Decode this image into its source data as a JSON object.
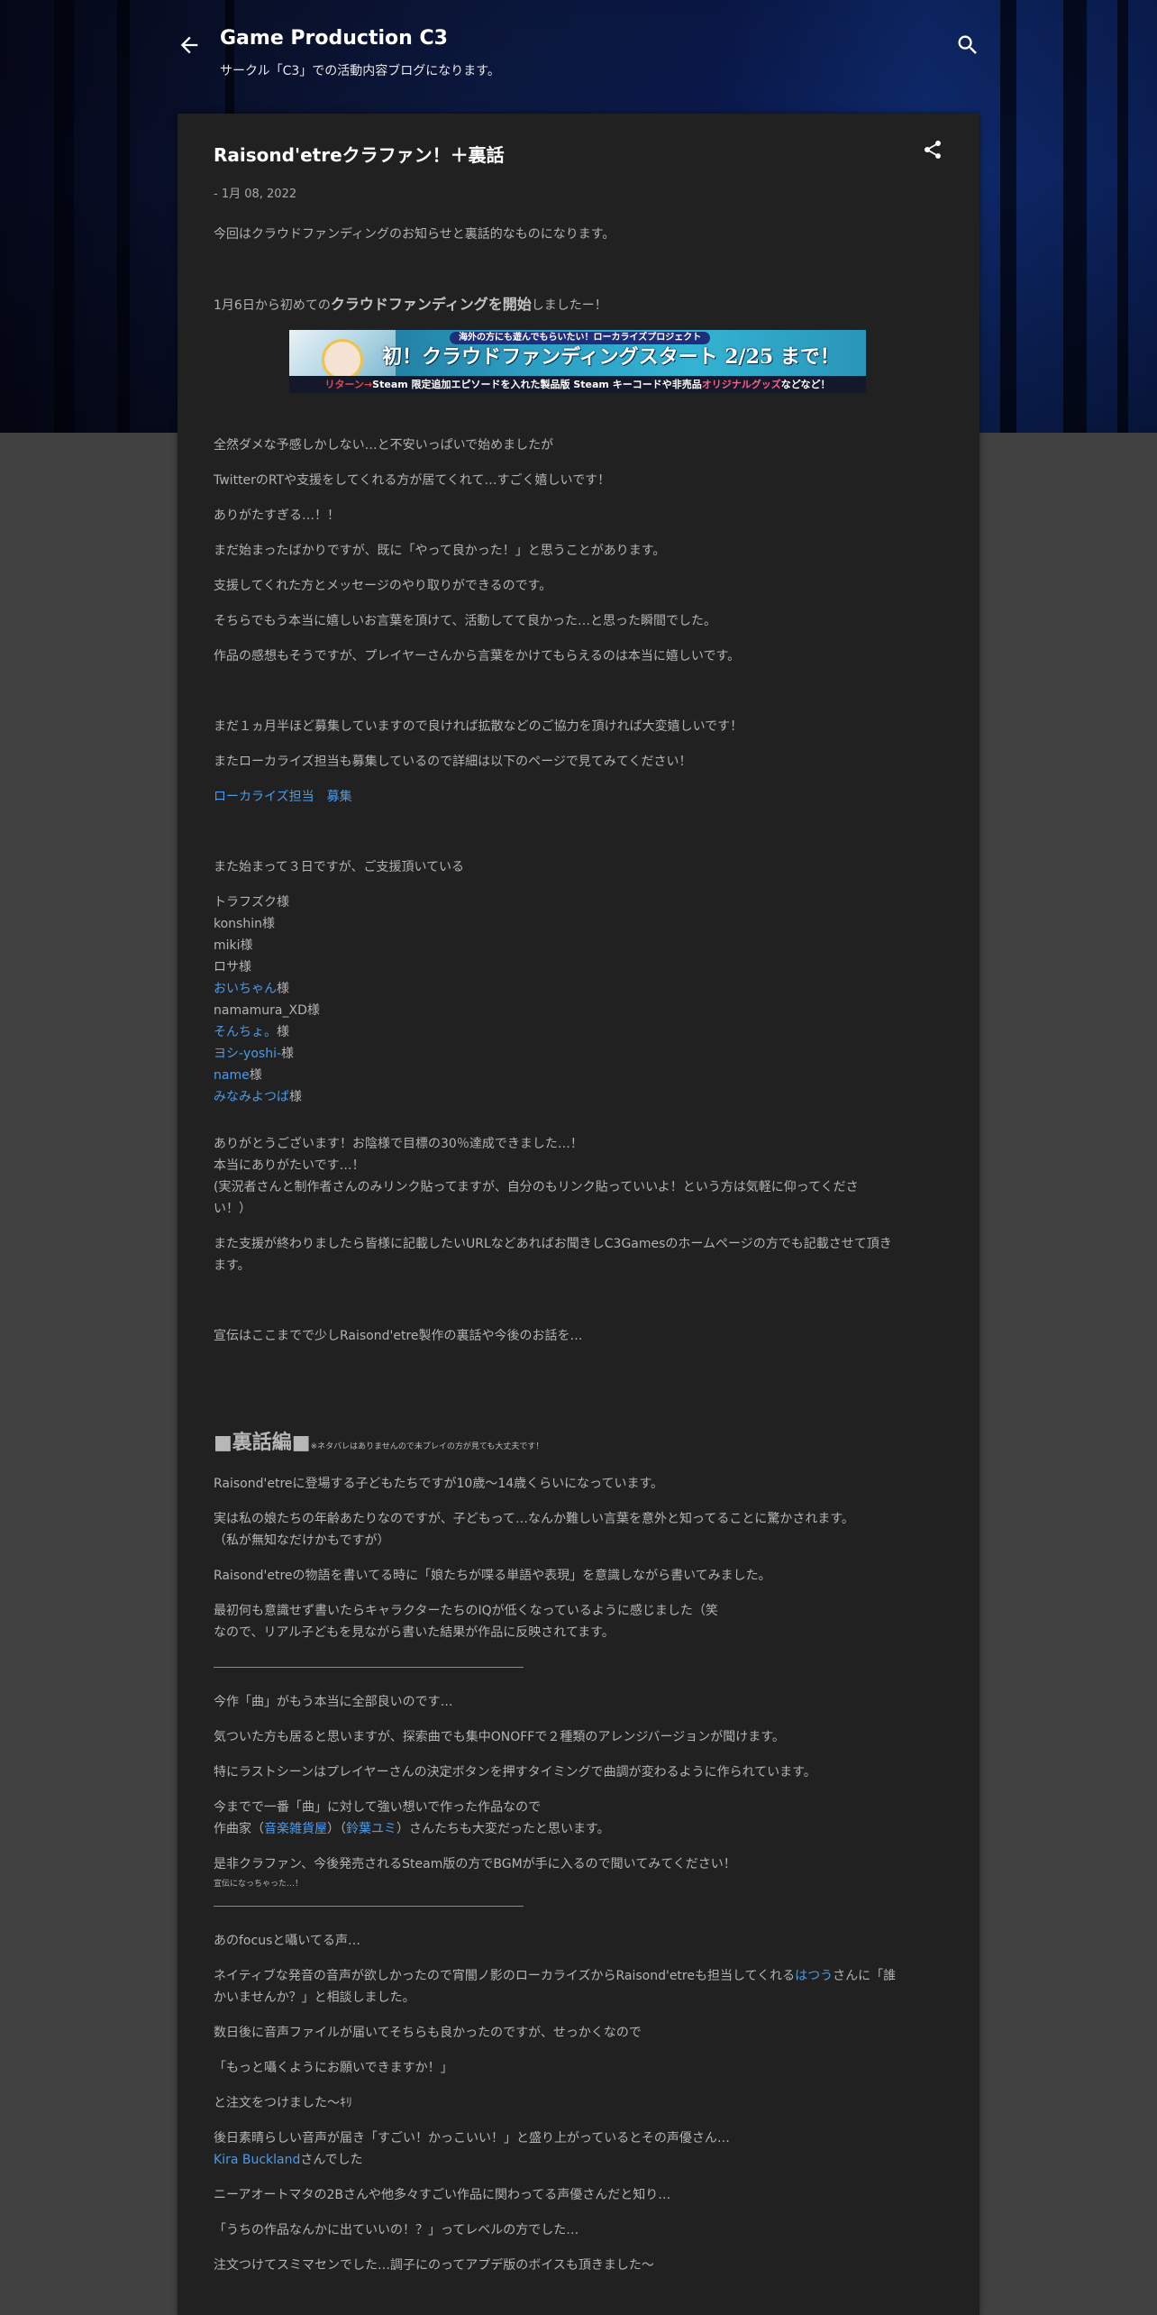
{
  "header": {
    "title": "Game Production C3",
    "description": "サークル「C3」での活動内容ブログになります。",
    "back_icon": "arrow-back-icon",
    "search_icon": "search-icon"
  },
  "post": {
    "title": "Raisond'etreクラファン！＋裏話",
    "date": "- 1月 08, 2022",
    "share_icon": "share-icon",
    "intro": "今回はクラウドファンディングのお知らせと裏話的なものになります。",
    "start_prefix": "1月6日から初めての",
    "start_bold": "クラウドファンディングを開始",
    "start_suffix": "しましたー！",
    "banner": {
      "pill": "海外の方にも遊んでもらいたい！ローカライズプロジェクト",
      "main": "初！クラウドファンディングスタート 2/25 まで！",
      "sub_red": "リターン→",
      "sub_mid": "Steam 限定追加エピソードを入れた製品版 Steam キーコードや非売品",
      "sub_pink": "オリジナルグッズ",
      "sub_end": "などなど！"
    },
    "p1": "全然ダメな予感しかしない…と不安いっぱいで始めましたが",
    "p2": "TwitterのRTや支援をしてくれる方が居てくれて…すごく嬉しいです！",
    "p3": "ありがたすぎる…！！",
    "p4": "まだ始まったばかりですが、既に「やって良かった！」と思うことがあります。",
    "p5": "支援してくれた方とメッセージのやり取りができるのです。",
    "p6": "そちらでもう本当に嬉しいお言葉を頂けて、活動してて良かった…と思った瞬間でした。",
    "p7": "作品の感想もそうですが、プレイヤーさんから言葉をかけてもらえるのは本当に嬉しいです。",
    "p8": "まだ１ヵ月半ほど募集していますので良ければ拡散などのご協力を頂ければ大変嬉しいです！",
    "p9": "またローカライズ担当も募集しているので詳細は以下のページで見てみてください！",
    "localize_link": "ローカライズ担当　募集",
    "supporters_intro": "また始まって３日ですが、ご支援頂いている",
    "supporters": [
      {
        "name": "トラフズク",
        "suffix": "様",
        "link": false
      },
      {
        "name": "konshin",
        "suffix": "様",
        "link": false
      },
      {
        "name": "miki",
        "suffix": "様",
        "link": false
      },
      {
        "name": "ロサ",
        "suffix": "様",
        "link": false
      },
      {
        "name": "おいちゃん",
        "suffix": "様",
        "link": true
      },
      {
        "name": "namamura_XD",
        "suffix": "様",
        "link": false
      },
      {
        "name": "そんちょ。",
        "suffix": "様",
        "link": true
      },
      {
        "name": "ヨシ-yoshi-",
        "suffix": "様",
        "link": true
      },
      {
        "name": "name",
        "suffix": "様",
        "link": true
      },
      {
        "name": "みなみよつば",
        "suffix": "様",
        "link": true
      }
    ],
    "thanks1": "ありがとうございます！お陰様で目標の30％達成できました…！",
    "thanks2": "本当にありがたいです…！",
    "thanks3": "(実況者さんと制作者さんのみリンク貼ってますが、自分のもリンク貼っていいよ！という方は気軽に仰ってくださ",
    "thanks4": "い！）",
    "url1": "また支援が終わりましたら皆様に記載したいURLなどあればお聞きしC3Gamesのホームページの方でも記載させて頂き",
    "url2": "ます。",
    "promo_end": "宣伝はここまでで少しRaisond'etre製作の裏話や今後のお話を…",
    "ura_heading": "■裏話編■",
    "ura_note": "※ネタバレはありませんので未プレイの方が見ても大丈夫です！",
    "u1": "Raisond'etreに登場する子どもたちですが10歳～14歳くらいになっています。",
    "u2a": "実は私の娘たちの年齢あたりなのですが、子どもって…なんか難しい言葉を意外と知ってることに驚かされます。",
    "u2b": "（私が無知なだけかもですが）",
    "u3": "Raisond'etreの物語を書いてる時に「娘たちが喋る単語や表現」を意識しながら書いてみました。",
    "u4a": "最初何も意識せず書いたらキャラクターたちのIQが低くなっているように感じました（笑",
    "u4b": "なので、リアル子どもを見ながら書いた結果が作品に反映されてます。",
    "m1": "今作「曲」がもう本当に全部良いのです…",
    "m2": "気ついた方も居ると思いますが、探索曲でも集中ONOFFで２種類のアレンジバージョンが聞けます。",
    "m3": "特にラストシーンはプレイヤーさんの決定ボタンを押すタイミングで曲調が変わるように作られています。",
    "m4": "今までで一番「曲」に対して強い想いで作った作品なので",
    "m5_a": "作曲家（",
    "m5_link1": "音楽雑貨屋",
    "m5_b": "）（",
    "m5_link2": "鈴葉ユミ",
    "m5_c": "）さんたちも大変だったと思います。",
    "m6": "是非クラファン、今後発売されるSteam版の方でBGMが手に入るので聞いてみてください！",
    "m7": "宣伝になっちゃった…！",
    "v1": "あのfocusと囁いてる声…",
    "v2a_1": "ネイティブな発音の音声が欲しかったので宵闇ノ影のローカライズからRaisond'etreも担当してくれる",
    "v2a_link": "はつう",
    "v2a_2": "さんに「誰",
    "v2b": "かいませんか？」と相談しました。",
    "v3": "数日後に音声ファイルが届いてそちらも良かったのですが、せっかくなので",
    "v4": "「もっと囁くようにお願いできますか！」",
    "v5": "と注文をつけました～ｷﾘ",
    "v6": "後日素晴らしい音声が届き「すごい！かっこいい！」と盛り上がっているとその声優さん…",
    "v7_link": "Kira Buckland",
    "v7_suffix": "さんでした",
    "v8": "ニーアオートマタの2Bさんや他多々すごい作品に関わってる声優さんだと知り…",
    "v9": "「うちの作品なんかに出ていいの！？」ってレベルの方でした…",
    "v10": "注文つけてスミマセンでした…調子にのってアプデ版のボイスも頂きました～"
  },
  "colors": {
    "page_bg": "#414141",
    "card_bg": "#212121",
    "link": "#4d9be8",
    "text": "#b3b3b3"
  }
}
